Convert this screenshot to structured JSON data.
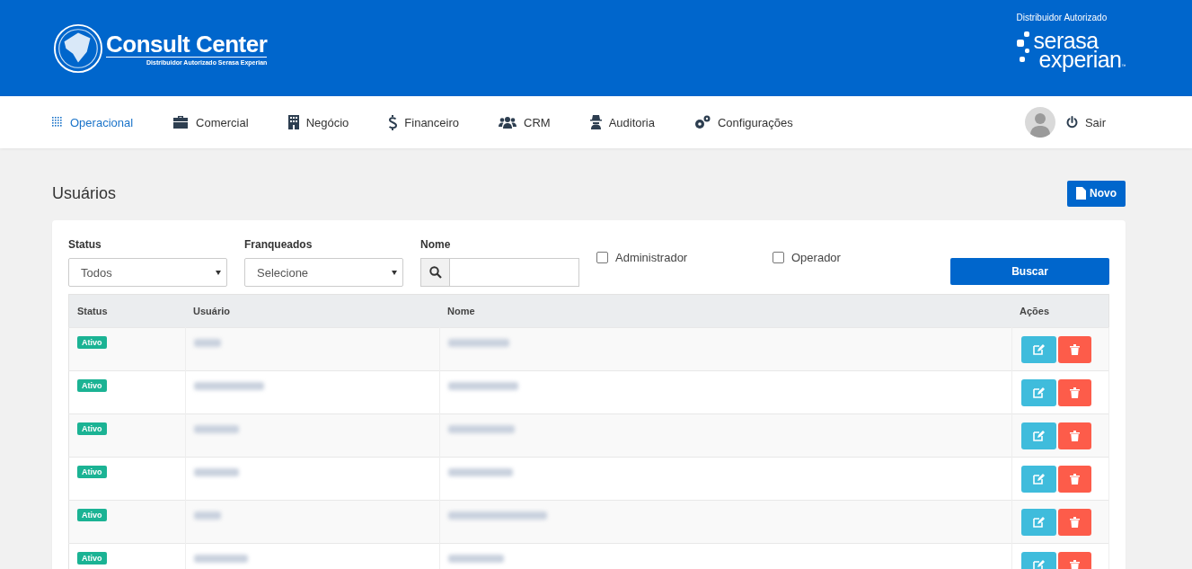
{
  "header": {
    "logo_title": "Consult Center",
    "logo_subtitle": "Distribuidor Autorizado Serasa Experian",
    "partner_caption": "Distribuidor Autorizado",
    "partner_line_1": "serasa",
    "partner_line_2": "experian",
    "partner_mark": "™"
  },
  "nav": {
    "items": [
      {
        "label": "Operacional",
        "selected": true
      },
      {
        "label": "Comercial",
        "selected": false
      },
      {
        "label": "Negócio",
        "selected": false
      },
      {
        "label": "Financeiro",
        "selected": false
      },
      {
        "label": "CRM",
        "selected": false
      },
      {
        "label": "Auditoria",
        "selected": false
      },
      {
        "label": "Configurações",
        "selected": false
      }
    ],
    "logout": "Sair"
  },
  "page": {
    "title": "Usuários",
    "new_button": "Novo"
  },
  "filters": {
    "status": {
      "label": "Status",
      "value": "Todos"
    },
    "franchise": {
      "label": "Franqueados",
      "value": "Selecione"
    },
    "name": {
      "label": "Nome"
    },
    "checkboxes": [
      {
        "label": "Administrador",
        "checked": false
      },
      {
        "label": "Operador",
        "checked": false
      }
    ],
    "search_button": "Buscar"
  },
  "table": {
    "columns": [
      "Status",
      "Usuário",
      "Nome",
      "Ações"
    ],
    "rows": [
      {
        "status": "Ativo"
      },
      {
        "status": "Ativo"
      },
      {
        "status": "Ativo"
      },
      {
        "status": "Ativo"
      },
      {
        "status": "Ativo"
      },
      {
        "status": "Ativo"
      }
    ]
  }
}
